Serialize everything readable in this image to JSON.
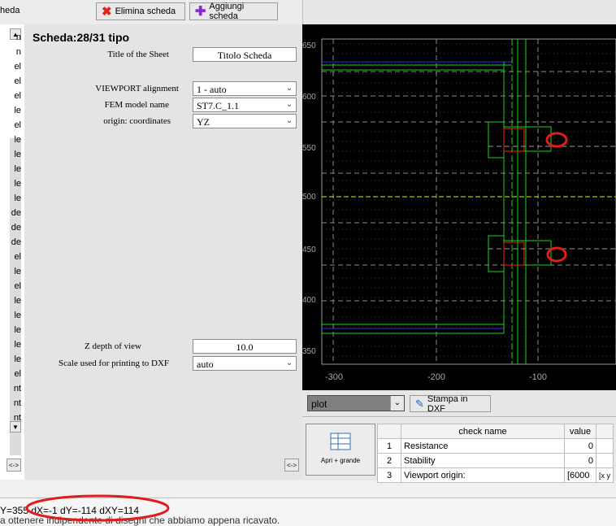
{
  "toolbar": {
    "tab_label": "heda",
    "delete_sheet_label": "Elimina scheda",
    "add_sheet_label": "Aggiungi scheda"
  },
  "left_list": {
    "items": [
      "n",
      "n",
      "el",
      "el",
      "el",
      "le",
      "el",
      "le",
      "le",
      "le",
      "le",
      "le",
      "de",
      "de",
      "de",
      "el",
      "le",
      "el",
      "le",
      "le",
      "le",
      "le",
      "le",
      "el",
      "nt",
      "nt",
      "nt"
    ]
  },
  "props": {
    "sheet_title": "Scheda:28/31 tipo",
    "title_label": "Title of the Sheet",
    "title_value": "Titolo Scheda",
    "viewport_label": "VIEWPORT alignment",
    "viewport_value": "1 - auto",
    "fem_label": "FEM model name",
    "fem_value": "ST7.C_1.1",
    "origin_label": "origin: coordinates",
    "origin_value": "YZ",
    "zdepth_label": "Z depth of view",
    "zdepth_value": "10.0",
    "scale_label": "Scale used for printing to DXF",
    "scale_value": "auto"
  },
  "plot": {
    "y_ticks": [
      "650",
      "600",
      "550",
      "500",
      "450",
      "400",
      "350"
    ],
    "x_ticks": [
      "-300",
      "-200",
      "-100"
    ],
    "plot_select_value": "plot",
    "print_dxf_label": "Stampa in DXF"
  },
  "results": {
    "open_big_label": "Apri + grande",
    "col_name": "check name",
    "col_value": "value",
    "rows": [
      {
        "n": "1",
        "name": "Resistance",
        "value": "0"
      },
      {
        "n": "2",
        "name": "Stability",
        "value": "0"
      },
      {
        "n": "3",
        "name": "Viewport origin:",
        "value": "[6000"
      }
    ],
    "row3_extra": "[x y"
  },
  "status": {
    "text": "Y=355  dX=-1 dY=-114 dXY=114",
    "ghost": "a ottenere                 indipendente di disegni che abbiamo appena ricavato."
  },
  "colors": {
    "plot_bg": "#000000",
    "green": "#19d219",
    "blue": "#2030ff",
    "red": "#ff2020",
    "yellow": "#e8e800",
    "annotation": "#e21b1b"
  }
}
